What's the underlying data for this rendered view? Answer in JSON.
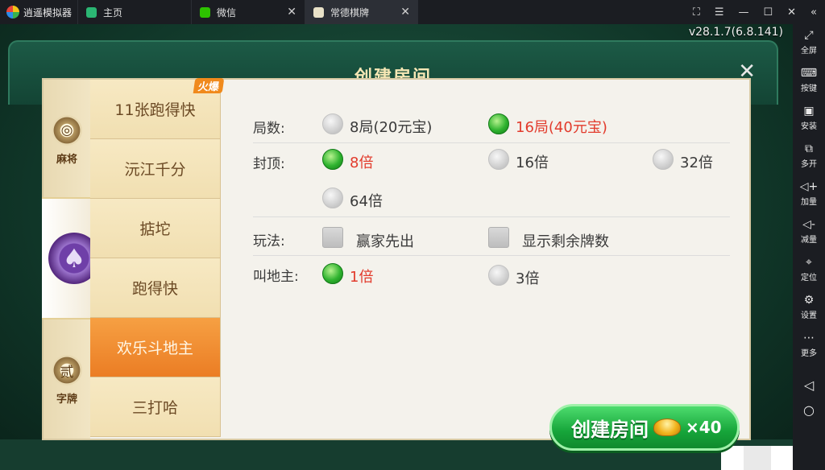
{
  "emulator": {
    "app_name": "逍遥模拟器",
    "tabs": [
      {
        "label": "主页"
      },
      {
        "label": "微信"
      },
      {
        "label": "常德棋牌"
      }
    ],
    "version": "v28.1.7(6.8.141)",
    "sidebar": [
      {
        "icon": "fullscreen-icon",
        "label": "全屏"
      },
      {
        "icon": "keyboard-icon",
        "label": "按键"
      },
      {
        "icon": "apk-install-icon",
        "label": "安装"
      },
      {
        "icon": "multi-open-icon",
        "label": "多开"
      },
      {
        "icon": "volume-up-icon",
        "label": "加量"
      },
      {
        "icon": "volume-down-icon",
        "label": "减量"
      },
      {
        "icon": "location-icon",
        "label": "定位"
      },
      {
        "icon": "settings-icon",
        "label": "设置"
      },
      {
        "icon": "more-icon",
        "label": "更多"
      }
    ]
  },
  "dialog": {
    "title": "创建房间",
    "categories": [
      {
        "label": "麻将",
        "glyph": "◎"
      },
      {
        "label": "",
        "glyph": "♠"
      },
      {
        "label": "字牌",
        "glyph": "贰"
      }
    ],
    "games": [
      {
        "label": "11张跑得快",
        "tag": "火爆"
      },
      {
        "label": "沅江千分"
      },
      {
        "label": "掂坨"
      },
      {
        "label": "跑得快"
      },
      {
        "label": "欢乐斗地主"
      },
      {
        "label": "三打哈"
      }
    ],
    "options": {
      "rounds": {
        "label": "局数:",
        "choices": [
          "8局(20元宝)",
          "16局(40元宝)"
        ]
      },
      "cap": {
        "label": "封顶:",
        "choices": [
          "8倍",
          "16倍",
          "32倍",
          "64倍"
        ]
      },
      "play": {
        "label": "玩法:",
        "choices": [
          "赢家先出",
          "显示剩余牌数"
        ]
      },
      "landlord": {
        "label": "叫地主:",
        "choices": [
          "1倍",
          "3倍"
        ]
      }
    },
    "create_button": {
      "label": "创建房间",
      "cost": "×40"
    }
  }
}
